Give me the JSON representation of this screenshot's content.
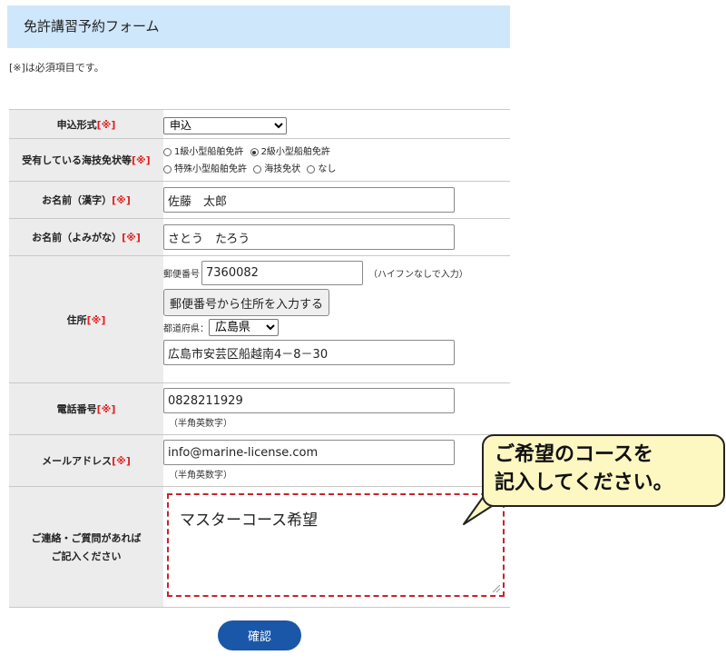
{
  "form": {
    "title": "免許講習予約フォーム",
    "required_note": "[※]は必須項目です。",
    "required_mark": "[※]",
    "rows": {
      "application_type": {
        "label": "申込形式",
        "selected": "申込"
      },
      "license": {
        "label": "受有している海技免状等",
        "options": [
          "1級小型船舶免許",
          "2級小型船舶免許",
          "特殊小型船舶免許",
          "海技免状",
          "なし"
        ],
        "selected": "2級小型船舶免許"
      },
      "name_kanji": {
        "label": "お名前（漢字）",
        "value": "佐藤　太郎"
      },
      "name_kana": {
        "label": "お名前（よみがな）",
        "value": "さとう　たろう"
      },
      "address": {
        "label": "住所",
        "postal_label": "郵便番号",
        "postal_value": "7360082",
        "postal_hint": "（ハイフンなしで入力）",
        "lookup_button": "郵便番号から住所を入力する",
        "prefecture_label": "都道府県：",
        "prefecture_value": "広島県",
        "street_value": "広島市安芸区船越南4－8－30"
      },
      "phone": {
        "label": "電話番号",
        "value": "0828211929",
        "hint": "（半角英数字）"
      },
      "email": {
        "label": "メールアドレス",
        "value": "info@marine-license.com",
        "hint": "（半角英数字）"
      },
      "message": {
        "label_line1": "ご連絡・ご質問があれば",
        "label_line2": "ご記入ください",
        "value": "マスターコース希望"
      }
    },
    "confirm_button": "確認"
  },
  "callout": {
    "line1": "ご希望のコースを",
    "line2": "記入してください。"
  },
  "colors": {
    "header_bg": "#cfe7fb",
    "required": "#e02020",
    "confirm_bg": "#1a57a8",
    "highlight_border": "#c8232a",
    "callout_bg": "#fdf7c2"
  }
}
